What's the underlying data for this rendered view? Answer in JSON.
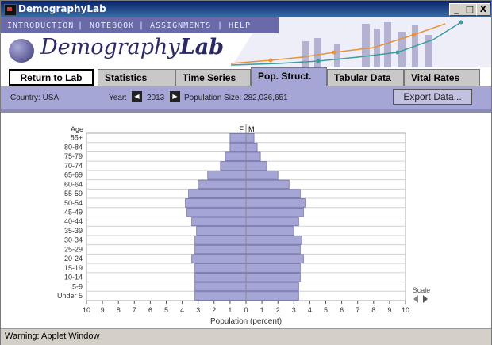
{
  "window": {
    "title": "DemographyLab",
    "controls": [
      "_",
      "□",
      "X"
    ]
  },
  "banner": {
    "menu": [
      "INTRODUCTION",
      "|",
      "NOTEBOOK",
      "|",
      "ASSIGNMENTS",
      "|",
      "HELP"
    ],
    "logo_plain": "Demography",
    "logo_bold": "Lab"
  },
  "tabs": {
    "return_label": "Return to Lab",
    "items": [
      "Statistics",
      "Time Series",
      "Pop. Struct.",
      "Tabular Data",
      "Vital Rates"
    ],
    "active": "Pop. Struct."
  },
  "controls": {
    "country": "Country: USA",
    "year_label": "Year:",
    "year": "2013",
    "pop_size": "Population Size: 282,036,651",
    "export_label": "Export Data..."
  },
  "chart_data": {
    "type": "bar",
    "subtype": "population-pyramid",
    "title": "",
    "xlabel": "Population (percent)",
    "ylabel": "Age",
    "xlim": [
      -10,
      10
    ],
    "x_ticks": [
      "10",
      "9",
      "8",
      "7",
      "6",
      "5",
      "4",
      "3",
      "2",
      "1",
      "0",
      "1",
      "2",
      "3",
      "4",
      "5",
      "6",
      "7",
      "8",
      "9",
      "10"
    ],
    "side_labels": {
      "female": "F",
      "male": "M"
    },
    "categories": [
      "85+",
      "80-84",
      "75-79",
      "70-74",
      "65-69",
      "60-64",
      "55-59",
      "50-54",
      "45-49",
      "40-44",
      "35-39",
      "30-34",
      "25-29",
      "20-24",
      "15-19",
      "10-14",
      "5-9",
      "Under 5"
    ],
    "series": [
      {
        "name": "F",
        "values": [
          1.0,
          1.0,
          1.3,
          1.6,
          2.4,
          3.0,
          3.6,
          3.8,
          3.7,
          3.4,
          3.1,
          3.2,
          3.2,
          3.4,
          3.2,
          3.2,
          3.2,
          3.2
        ]
      },
      {
        "name": "M",
        "values": [
          0.5,
          0.7,
          0.9,
          1.3,
          2.0,
          2.7,
          3.4,
          3.7,
          3.6,
          3.3,
          3.0,
          3.5,
          3.4,
          3.6,
          3.4,
          3.4,
          3.3,
          3.3
        ]
      }
    ],
    "grid": true,
    "bar_color": "#a6a6d6",
    "scale_label": "Scale"
  },
  "status": {
    "text": "Warning: Applet Window"
  }
}
